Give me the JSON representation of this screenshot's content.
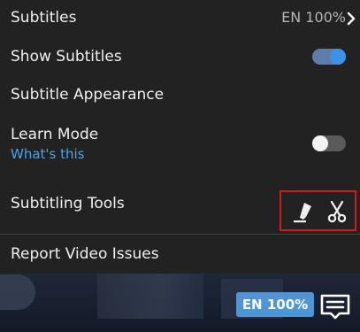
{
  "menu": {
    "subtitles": {
      "label": "Subtitles",
      "value": "EN 100%",
      "chevron_icon": "chevron-right-icon"
    },
    "show_subtitles": {
      "label": "Show Subtitles",
      "enabled": true
    },
    "appearance": {
      "label": "Subtitle Appearance"
    },
    "learn_mode": {
      "label": "Learn Mode",
      "link": "What's this",
      "enabled": false
    },
    "subtitling_tools": {
      "label": "Subtitling Tools",
      "icons": [
        "marker-icon",
        "scissors-icon"
      ]
    },
    "report": {
      "label": "Report Video Issues"
    }
  },
  "player": {
    "language_badge": "EN 100%",
    "subtitles_button_icon": "subtitles-icon"
  },
  "colors": {
    "menu_bg": "#222222",
    "text": "#f0f0f0",
    "link": "#4aa3e6",
    "toggle_on": "#3e91e8",
    "highlight_box": "#d11a1a",
    "badge_bg": "#4f95d6"
  }
}
